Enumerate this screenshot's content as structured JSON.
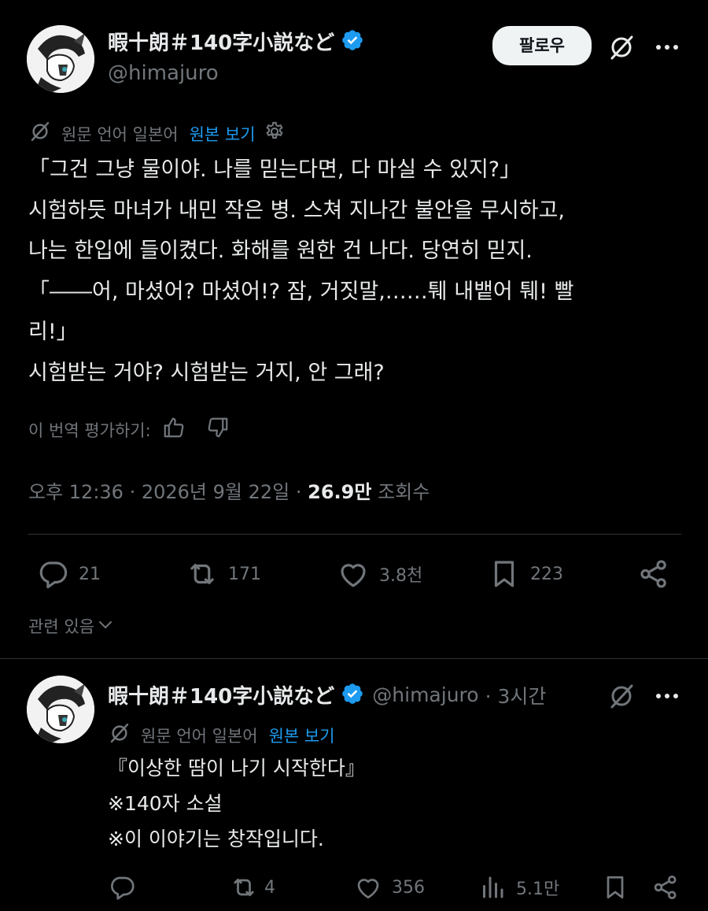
{
  "main_tweet": {
    "author_name": "暇十朗＃140字小説など",
    "handle": "@himajuro",
    "follow_label": "팔로우",
    "translation_bar": {
      "label": "원문 언어 일본어",
      "link": "원본 보기"
    },
    "body": [
      "「그건 그냥 물이야. 나를 믿는다면, 다 마실 수 있지?」",
      "시험하듯 마녀가 내민 작은 병. 스쳐 지나간 불안을 무시하고,",
      "나는 한입에 들이켰다. 화해를 원한 건 나다. 당연히 믿지.",
      "「――어, 마셨어? 마셨어!? 잠, 거짓말,……퉤 내뱉어 퉤! 빨",
      "리!」",
      "시험받는 거야? 시험받는 거지, 안 그래?"
    ],
    "rate_label": "이 번역 평가하기:",
    "timestamp": "오후 12:36 · 2026년 9월 22일",
    "views_value": "26.9만",
    "views_label": "조회수",
    "separator": " · ",
    "stats": {
      "replies": "21",
      "reposts": "171",
      "likes": "3.8천",
      "bookmarks": "223"
    },
    "related_label": "관련 있음"
  },
  "reply_tweet": {
    "author_name": "暇十朗＃140字小説など",
    "handle": "@himajuro",
    "time": "· 3시간",
    "translation_bar": {
      "label": "원문 언어 일본어",
      "link": "원본 보기"
    },
    "body": [
      "『이상한 땀이 나기 시작한다』",
      "※140자 소설",
      "※이 이야기는 창작입니다."
    ],
    "stats": {
      "replies": "",
      "reposts": "4",
      "likes": "356",
      "views": "5.1만"
    }
  },
  "colors": {
    "background": "#000000",
    "text": "#e7e9ea",
    "muted": "#71767b",
    "link": "#1d9bf0",
    "divider": "#2f3336"
  }
}
